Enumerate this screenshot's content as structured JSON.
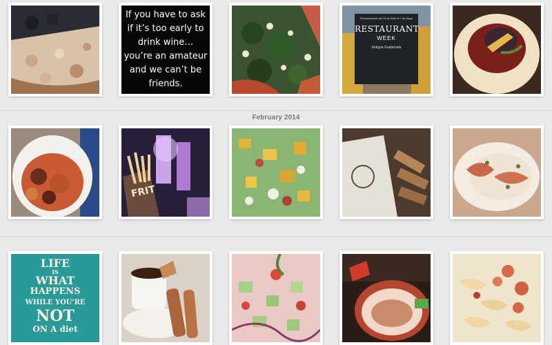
{
  "gallery": {
    "section_label": "February 2014",
    "rows": [
      {
        "tiles": [
          {
            "subject": "pizza-slices"
          },
          {
            "subject": "wine-quote",
            "text": "If you have to ask if it’s too early to drink wine… you’re an amateur and we can’t be friends."
          },
          {
            "subject": "spinach-pizza"
          },
          {
            "subject": "restaurant-week-poster",
            "poster": {
              "dates": "Próximamente del 23 de Abril al 7 de Mayo",
              "title": "RESTAURANT",
              "subtitle": "WEEK",
              "city": "Antigua Guatemala"
            }
          },
          {
            "subject": "plated-dessert"
          }
        ]
      },
      {
        "tiles": [
          {
            "subject": "calamari-bowl"
          },
          {
            "subject": "fries-cup",
            "text": "FRIT"
          },
          {
            "subject": "salad-mango"
          },
          {
            "subject": "churros-bag"
          },
          {
            "subject": "shrimp-plate"
          }
        ]
      },
      {
        "tiles": [
          {
            "subject": "life-poster",
            "lines": [
              "LIFE",
              "IS",
              "WHAT",
              "HAPPENS",
              "WHILE YOU'RE",
              "NOT",
              "ON A diet"
            ]
          },
          {
            "subject": "chocolate-churros"
          },
          {
            "subject": "ceviche"
          },
          {
            "subject": "soup-bowl"
          },
          {
            "subject": "pasta-shrimp"
          }
        ]
      }
    ]
  },
  "colors": {
    "background": "#e9e9e9",
    "tile_border": "#ffffff",
    "label": "#7a7a7a"
  }
}
